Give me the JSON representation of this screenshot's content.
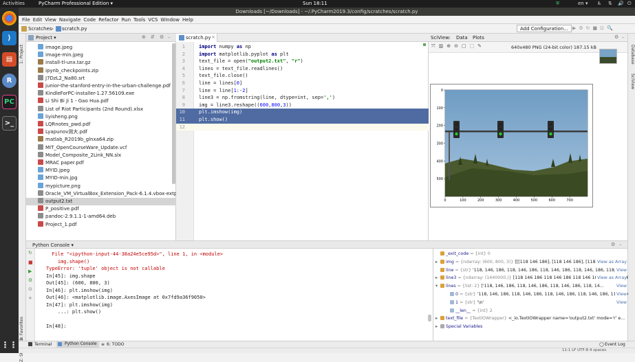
{
  "topbar": {
    "activities": "Activities",
    "app": "PyCharm Professional Edition ▾",
    "clock": "Sun 18:11",
    "lang": "en ▾"
  },
  "window": {
    "title": "Downloads [~/Downloads] - ~/.PyCharm2019.3/config/scratches/scratch.py"
  },
  "menu": [
    "File",
    "Edit",
    "View",
    "Navigate",
    "Code",
    "Refactor",
    "Run",
    "Tools",
    "VCS",
    "Window",
    "Help"
  ],
  "nav": {
    "crumb1": "Scratches",
    "crumb2": "scratch.py",
    "run_config": "Add Configuration..."
  },
  "side_tabs": {
    "project": "1: Project",
    "favorites": "2: Favorites",
    "structure": "Z: Structure",
    "database": "Database",
    "sciview": "SciView"
  },
  "project": {
    "title": "Project ▾",
    "files": [
      {
        "name": "image.jpeg",
        "kind": "img"
      },
      {
        "name": "image-min.jpeg",
        "kind": "img"
      },
      {
        "name": "install-tl-unx.tar.gz",
        "kind": "arc"
      },
      {
        "name": "ipynb_checkpoints.zip",
        "kind": "arc"
      },
      {
        "name": "J7DzL2_Na80.srt",
        "kind": "txt"
      },
      {
        "name": "junior-the-stanford-entry-in-the-urban-challenge.pdf",
        "kind": "pdf"
      },
      {
        "name": "KindleForPC-installer-1.27.56109.exe",
        "kind": "txt"
      },
      {
        "name": "Li Shi Bi Ji 1 - Gao Hua.pdf",
        "kind": "pdf"
      },
      {
        "name": "List of Riot Participants (2nd Round).xlsx",
        "kind": "txt"
      },
      {
        "name": "liyisheng.png",
        "kind": "img"
      },
      {
        "name": "LQRnotes_pwd.pdf",
        "kind": "pdf"
      },
      {
        "name": "Lyapunov测大.pdf",
        "kind": "pdf"
      },
      {
        "name": "matlab_R2019b_glnxa64.zip",
        "kind": "arc"
      },
      {
        "name": "MIT_OpenCourseWare_Update.vcf",
        "kind": "txt"
      },
      {
        "name": "Model_Composite_2Link_NN.slx",
        "kind": "txt"
      },
      {
        "name": "MRAC paper.pdf",
        "kind": "pdf"
      },
      {
        "name": "MYID.jpeg",
        "kind": "img"
      },
      {
        "name": "MYID-min.jpg",
        "kind": "img"
      },
      {
        "name": "mypicture.png",
        "kind": "img"
      },
      {
        "name": "Oracle_VM_VirtualBox_Extension_Pack-6.1.4.vbox-extpac",
        "kind": "txt"
      },
      {
        "name": "output2.txt",
        "kind": "txt"
      },
      {
        "name": "P_positive.pdf",
        "kind": "pdf"
      },
      {
        "name": "pandoc-2.9.1.1-1-amd64.deb",
        "kind": "txt"
      },
      {
        "name": "Project_1.pdf",
        "kind": "pdf"
      }
    ]
  },
  "editor": {
    "tab": "scratch.py",
    "lines": [
      "<span class='kw'>import</span> numpy <span class='kw'>as</span> np",
      "<span class='kw'>import</span> matplotlib.pyplot <span class='kw'>as</span> plt",
      "text_file = open(<span class='str'>\"output2.txt\"</span>, <span class='str'>\"r\"</span>)",
      "lines = text_file.readlines()",
      "text_file.close()",
      "line = lines[<span class='num'>0</span>]",
      "line = line[<span class='num'>1</span>:-<span class='num'>2</span>]",
      "line3 = np.fromstring(line, dtype=int, sep=<span class='str'>','</span>)",
      "img = line3.reshape((<span class='num'>600</span>,<span class='num'>800</span>,<span class='num'>3</span>))",
      "plt.imshow(img)",
      "plt.show()",
      ""
    ]
  },
  "sciview": {
    "tabs": [
      "SciView:",
      "Data",
      "Plots"
    ],
    "info": "640x480 PNG (24-bit color) 187.15 kB",
    "y_ticks": [
      "0",
      "100",
      "200",
      "300",
      "400",
      "500"
    ],
    "x_ticks": [
      "0",
      "100",
      "200",
      "300",
      "400",
      "500",
      "600",
      "700"
    ]
  },
  "console": {
    "title": "Python Console ▾",
    "lines": [
      {
        "text": "  File \"<ipython-input-44-38a24e5ce95d>\", line 1, in <module>",
        "color": "#c00000"
      },
      {
        "text": "    img.shape()",
        "color": "#c00000"
      },
      {
        "text": "TypeError: 'tuple' object is not callable",
        "color": "#c00000"
      },
      {
        "text": "In[45]: img.shape",
        "color": "#222222"
      },
      {
        "text": "Out[45]: (600, 800, 3)",
        "color": "#222222"
      },
      {
        "text": "In[46]: plt.imshow(img)",
        "color": "#222222"
      },
      {
        "text": "Out[46]: <matplotlib.image.AxesImage at 0x7fd9a36f9050>",
        "color": "#222222"
      },
      {
        "text": "In[47]: plt.imshow(img)",
        "color": "#222222"
      },
      {
        "text": "    ...: plt.show()",
        "color": "#222222"
      },
      {
        "text": "",
        "color": "#222222"
      },
      {
        "text": "In[48]:",
        "color": "#222222"
      }
    ]
  },
  "variables": [
    {
      "name": "_exit_code",
      "type": "= {int} 0",
      "value": "",
      "indent": 0,
      "arrow": "",
      "link": ""
    },
    {
      "name": "img",
      "type": "= {ndarray: (600, 800, 3)}",
      "value": "[[[118 146 186], [118 146 186], [118 ...",
      "indent": 0,
      "arrow": "▸",
      "link": "View as Array"
    },
    {
      "name": "line",
      "type": "= {str}",
      "value": "'118, 146, 186, 118, 146, 186, 118, 146, 186, 118, 146, 186, 118, 146, 186, 1...",
      "indent": 0,
      "arrow": "",
      "link": "View"
    },
    {
      "name": "line3",
      "type": "= {ndarray: (1440000,)}",
      "value": "[118 146 186 118 146 186 118 146 186 118 146 186 1...",
      "indent": 0,
      "arrow": "▸",
      "link": "View as Array"
    },
    {
      "name": "lines",
      "type": "= {list: 2}",
      "value": "['118, 146, 186, 118, 146, 186, 118, 146, 186, 118, 14...",
      "indent": 0,
      "arrow": "▾",
      "link": "View"
    },
    {
      "name": "0",
      "type": "= {str}",
      "value": "'118, 146, 186, 118, 146, 186, 118, 146, 186, 118, 146, 186, 118, 146, 186, 11...",
      "indent": 1,
      "arrow": "",
      "link": "View"
    },
    {
      "name": "1",
      "type": "= {str}",
      "value": "'\\n'",
      "indent": 1,
      "arrow": "",
      "link": "View"
    },
    {
      "name": "__len__",
      "type": "= {int} 2",
      "value": "",
      "indent": 1,
      "arrow": "",
      "link": ""
    },
    {
      "name": "text_file",
      "type": "= {TextIOWrapper}",
      "value": "<_io.TextIOWrapper name='output2.txt' mode='r' e...",
      "indent": 0,
      "arrow": "▸",
      "link": ""
    },
    {
      "name": "Special Variables",
      "type": "",
      "value": "",
      "indent": 0,
      "arrow": "▸",
      "link": ""
    }
  ],
  "bottom_tabs": [
    "Terminal",
    "Python Console",
    "6: TODO"
  ],
  "status": {
    "event_log": "Event Log",
    "position": "11:1  LF  UTF-8  4 spaces"
  },
  "colors": {
    "selection": "#4f6ba2",
    "sky": "#79a3c7",
    "ground": "#4a5a2e"
  }
}
